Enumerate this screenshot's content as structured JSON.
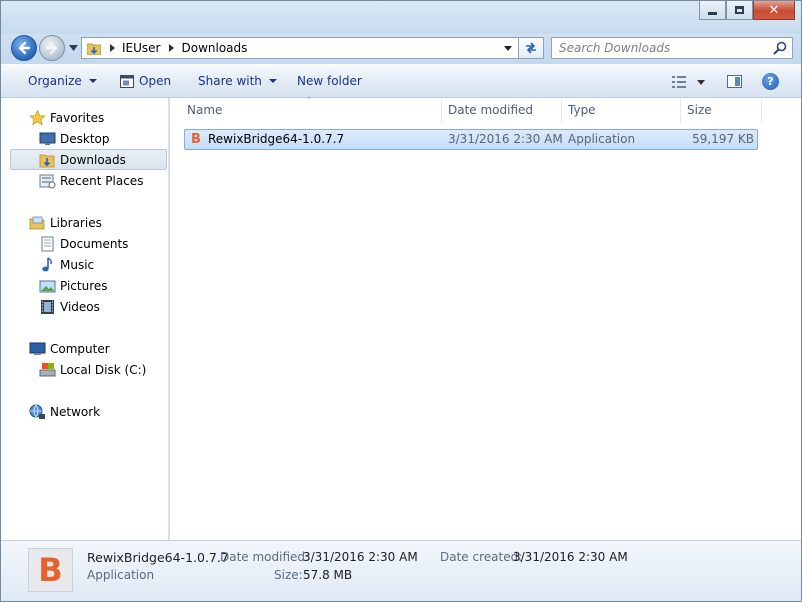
{
  "window": {
    "caption": {
      "close_glyph": "✕"
    }
  },
  "address": {
    "crumbs": [
      "IEUser",
      "Downloads"
    ]
  },
  "search": {
    "placeholder": "Search Downloads"
  },
  "toolbar": {
    "organize": "Organize",
    "open": "Open",
    "share_with": "Share with",
    "new_folder": "New folder",
    "help": "?"
  },
  "nav": {
    "favorites": "Favorites",
    "desktop": "Desktop",
    "downloads": "Downloads",
    "recent_places": "Recent Places",
    "libraries": "Libraries",
    "documents": "Documents",
    "music": "Music",
    "pictures": "Pictures",
    "videos": "Videos",
    "computer": "Computer",
    "local_disk": "Local Disk (C:)",
    "network": "Network"
  },
  "columns": {
    "name": "Name",
    "date_modified": "Date modified",
    "type": "Type",
    "size": "Size",
    "sort_indicator": "˄"
  },
  "files": [
    {
      "icon_letter": "B",
      "name": "RewixBridge64-1.0.7.7",
      "date_modified": "3/31/2016 2:30 AM",
      "type": "Application",
      "size": "59,197 KB"
    }
  ],
  "details": {
    "icon_letter": "B",
    "name": "RewixBridge64-1.0.7.7",
    "type": "Application",
    "date_modified_label": "Date modified:",
    "date_modified": "3/31/2016 2:30 AM",
    "date_created_label": "Date created:",
    "date_created": "3/31/2016 2:30 AM",
    "size_label": "Size:",
    "size": "57.8 MB"
  },
  "colors": {
    "accent": "#1e3287",
    "selection": "#c4ddf9",
    "app_icon": "#e4632a"
  }
}
